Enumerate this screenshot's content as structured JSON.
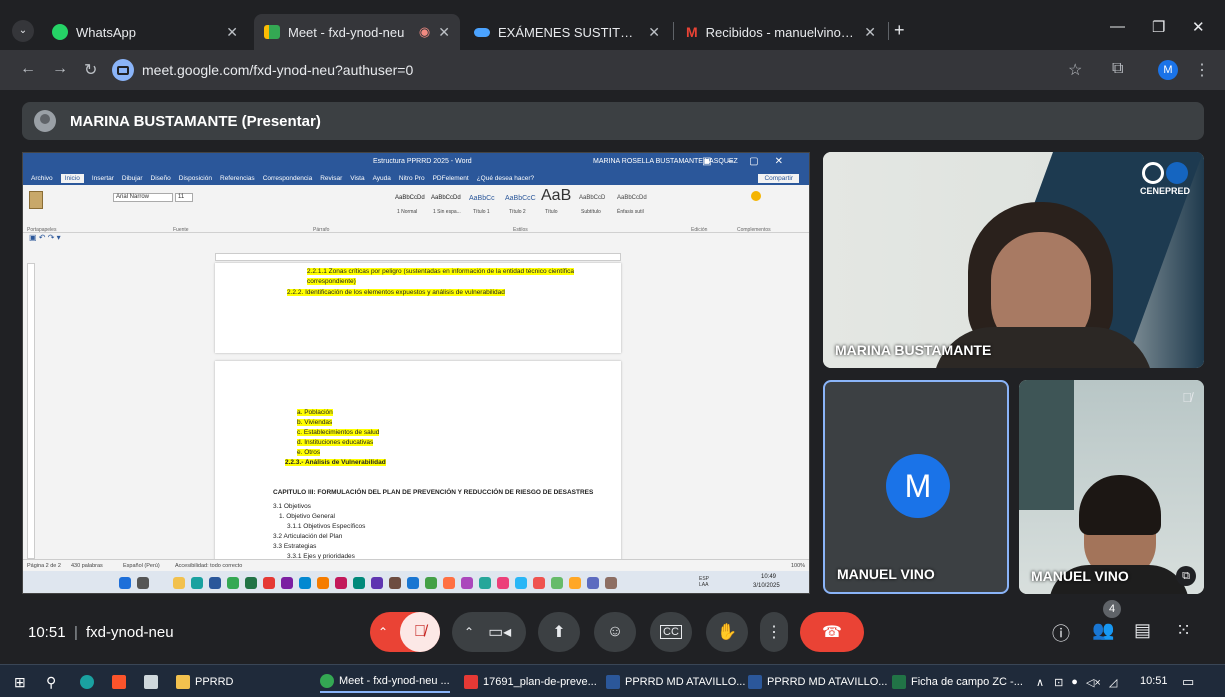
{
  "browser": {
    "tabs": [
      {
        "title": "WhatsApp",
        "icon": "whatsapp-icon",
        "active": false
      },
      {
        "title": "Meet - fxd-ynod-neu",
        "icon": "meet-icon",
        "active": true
      },
      {
        "title": "EXÁMENES SUSTITUTORIOS - C",
        "icon": "onedrive-icon",
        "active": false
      },
      {
        "title": "Recibidos - manuelvinovizarreta",
        "icon": "gmail-icon",
        "active": false
      }
    ],
    "new_tab": "+",
    "url": "meet.google.com/fxd-ynod-neu?authuser=0",
    "profile_letter": "M"
  },
  "presenter": {
    "label": "MARINA BUSTAMANTE (Presentar)"
  },
  "word": {
    "doc_title": "Estructura PPRRD 2025 - Word",
    "user": "MARINA ROSELLA BUSTAMANTE VASQUEZ",
    "menu": [
      "Archivo",
      "Inicio",
      "Insertar",
      "Dibujar",
      "Diseño",
      "Disposición",
      "Referencias",
      "Correspondencia",
      "Revisar",
      "Vista",
      "Ayuda",
      "Nitro Pro",
      "PDFelement",
      "¿Qué desea hacer?"
    ],
    "share_btn": "Compartir",
    "font": "Arial Narrow",
    "size": "11",
    "styles": [
      "AaBbCcDd",
      "AaBbCcDd",
      "AaBbCc",
      "AaBbCcC",
      "AaB",
      "AaBbCcD",
      "AaBbCcDd"
    ],
    "style_names": [
      "1 Normal",
      "1 Sin espa...",
      "Título 1",
      "Título 2",
      "Título",
      "Subtítulo",
      "Énfasis sutil"
    ],
    "groups": [
      "Portapapeles",
      "Fuente",
      "Párrafo",
      "Estilos",
      "Edición",
      "Complementos"
    ],
    "page1_lines": [
      "2.2.1.1 Zonas críticas por peligro (sustentadas en información de la entidad técnico científica",
      "correspondiente)",
      "2.2.2. Identificación de los elementos expuestos y análisis de vulnerabilidad"
    ],
    "page2_list": [
      "a.  Población",
      "b.  Viviendas",
      "c.  Establecimientos de salud",
      "d.  Instituciones educativas",
      "e.  Otros"
    ],
    "page2_heading": "2.2.3.- Análisis de Vulnerabilidad",
    "chapter": "CAPITULO III: FORMULACIÓN DEL PLAN DE PREVENCIÓN Y REDUCCIÓN DE RIESGO DE DESASTRES",
    "toc": [
      "3.1  Objetivos",
      "1.          Objetivo General",
      "3.1.1  Objetivos Específicos",
      "3.2  Articulación del Plan",
      "3.3  Estrategias",
      "3.3.1  Ejes y prioridades"
    ],
    "status_page": "Página 2 de 2",
    "status_words": "430 palabras",
    "status_lang": "Español (Perú)",
    "status_access": "Accesibilidad: todo correcto",
    "zoom": "100%",
    "tray_time": "10:49",
    "tray_date": "3/10/2025",
    "tray_lang": "ESP LAA"
  },
  "participants": [
    {
      "name": "MARINA BUSTAMANTE"
    },
    {
      "name": "MANUEL VINO",
      "initial": "M"
    },
    {
      "name": "MANUEL VINO"
    }
  ],
  "logo_text": "CENEPRED",
  "meeting": {
    "time": "10:51",
    "separator": "|",
    "code": "fxd-ynod-neu",
    "participant_count": "4"
  },
  "taskbar": {
    "items": [
      "PPRRD",
      "Meet - fxd-ynod-neu ...",
      "17691_plan-de-preve...",
      "PPRRD MD ATAVILLO...",
      "PPRRD MD ATAVILLO...",
      "Ficha de campo ZC -..."
    ],
    "clock": "10:51"
  }
}
